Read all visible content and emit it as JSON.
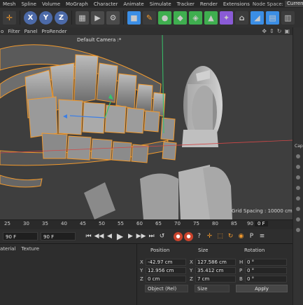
{
  "menu": {
    "items": [
      "Mesh",
      "Spline",
      "Volume",
      "MoGraph",
      "Character",
      "Animate",
      "Simulate",
      "Tracker",
      "Render",
      "Extensions"
    ],
    "node_space_label": "Node Space:",
    "node_space_value": "Current"
  },
  "toolbar": {
    "axis_x": "X",
    "axis_y": "Y",
    "axis_z": "Z"
  },
  "viewport_menu": {
    "items": [
      "o",
      "Filter",
      "Panel",
      "ProRender"
    ],
    "camera": "Default Camera :*",
    "grid_spacing": "Grid Spacing : 10000 cm"
  },
  "timeline": {
    "ticks": [
      "25",
      "30",
      "35",
      "40",
      "45",
      "50",
      "55",
      "60",
      "65",
      "70",
      "75",
      "80",
      "85",
      "90"
    ],
    "current_frame": "0 F",
    "start_frame": "90 F",
    "end_frame": "90 F"
  },
  "material": {
    "tabs": [
      "aterial",
      "Texture"
    ]
  },
  "coordinates": {
    "position_header": "Position",
    "size_header": "Size",
    "rotation_header": "Rotation",
    "rows": [
      {
        "pos_label": "X",
        "pos_value": "-42.97 cm",
        "size_label": "X",
        "size_value": "127.586 cm",
        "rot_label": "H",
        "rot_value": "0 °"
      },
      {
        "pos_label": "Y",
        "pos_value": "12.956 cm",
        "size_label": "Y",
        "size_value": "35.412 cm",
        "rot_label": "P",
        "rot_value": "0 °"
      },
      {
        "pos_label": "Z",
        "pos_value": "0 cm",
        "size_label": "Z",
        "size_value": "7 cm",
        "rot_label": "B",
        "rot_value": "0 °"
      }
    ],
    "mode_dropdown": "Object (Rel)",
    "size_dropdown": "Size",
    "apply_label": "Apply"
  },
  "side_panel": {
    "label": "Cap"
  },
  "colors": {
    "selection_outline": "#f29a2e",
    "accent_blue": "#3b8ee5",
    "viewport_bg": "#3d3d3d"
  }
}
